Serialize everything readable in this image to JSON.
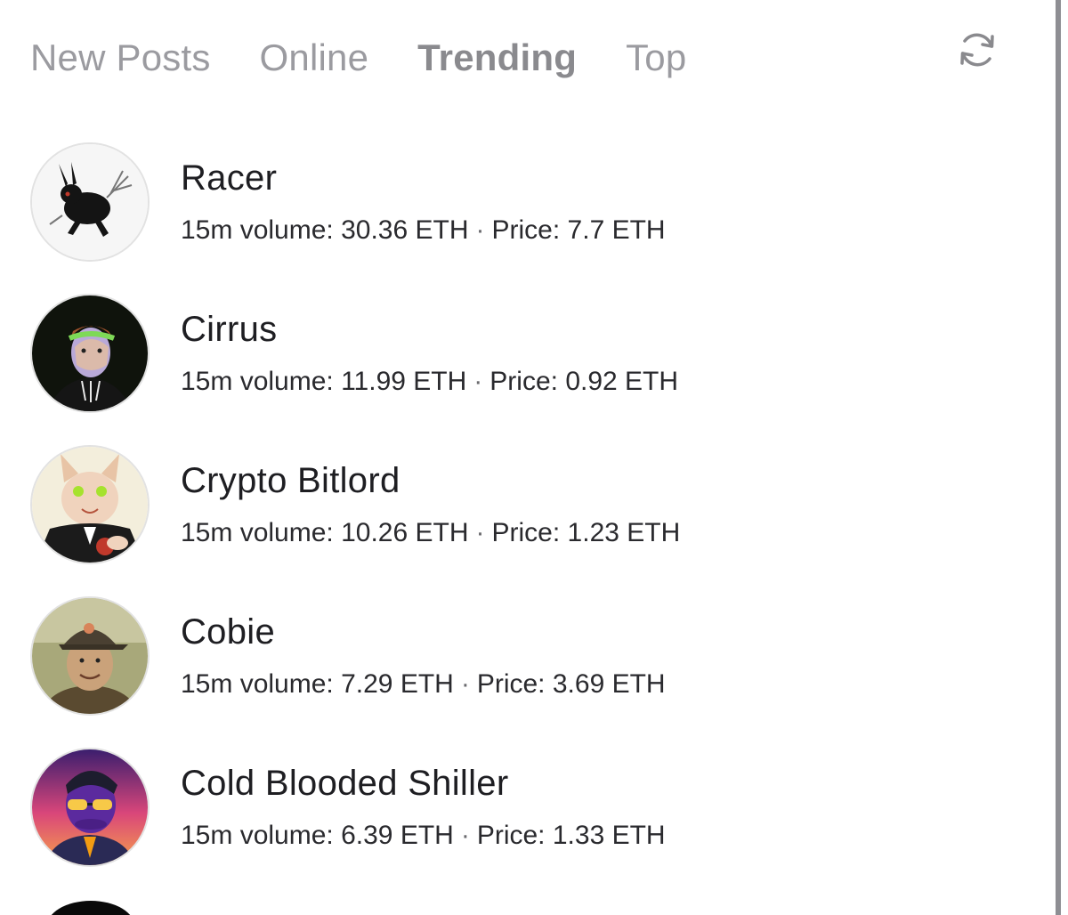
{
  "tabs": [
    {
      "label": "New Posts",
      "active": false
    },
    {
      "label": "Online",
      "active": false
    },
    {
      "label": "Trending",
      "active": true
    },
    {
      "label": "Top",
      "active": false
    }
  ],
  "refresh_icon": "refresh-icon",
  "rows": [
    {
      "name": "Racer",
      "volume_label": "15m volume:",
      "volume": "30.36 ETH",
      "separator": "·",
      "price_label": "Price:",
      "price": "7.7 ETH",
      "avatar": "black-rabbit-avatar"
    },
    {
      "name": "Cirrus",
      "volume_label": "15m volume:",
      "volume": "11.99 ETH",
      "separator": "·",
      "price_label": "Price:",
      "price": "0.92 ETH",
      "avatar": "laurel-character-avatar"
    },
    {
      "name": "Crypto Bitlord",
      "volume_label": "15m volume:",
      "volume": "10.26 ETH",
      "separator": "·",
      "price_label": "Price:",
      "price": "1.23 ETH",
      "avatar": "cat-in-suit-avatar"
    },
    {
      "name": "Cobie",
      "volume_label": "15m volume:",
      "volume": "7.29 ETH",
      "separator": "·",
      "price_label": "Price:",
      "price": "3.69 ETH",
      "avatar": "person-with-cap-avatar"
    },
    {
      "name": "Cold Blooded Shiller",
      "volume_label": "15m volume:",
      "volume": "6.39 ETH",
      "separator": "·",
      "price_label": "Price:",
      "price": "1.33 ETH",
      "avatar": "purple-character-avatar"
    }
  ]
}
